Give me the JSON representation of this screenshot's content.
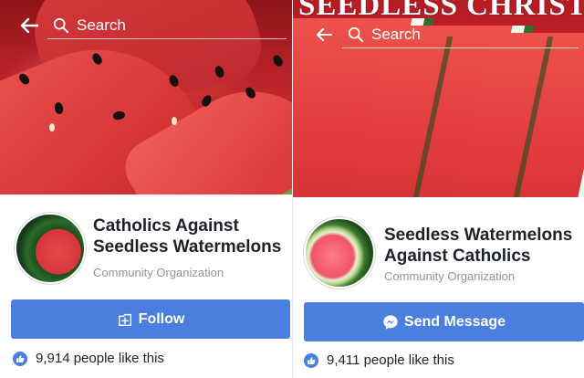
{
  "colors": {
    "button_blue": "#4a7fe0",
    "name_text": "#1d2129",
    "meta_text": "#90949c"
  },
  "left_page": {
    "search_placeholder": "Search",
    "name_line1": "Catholics Against",
    "name_line2": "Seedless Watermelons",
    "category": "Community Organization",
    "button_label": "Follow",
    "button_icon": "follow-plus-icon",
    "likes_text": "9,914 people like this"
  },
  "right_page": {
    "cover_title": "SEEDLESS CHRIST",
    "search_placeholder": "Search",
    "name_line1": "Seedless Watermelons",
    "name_line2": "Against Catholics",
    "category": "Community Organization",
    "button_label": "Send Message",
    "button_icon": "messenger-icon",
    "likes_text": "9,411 people like this"
  }
}
